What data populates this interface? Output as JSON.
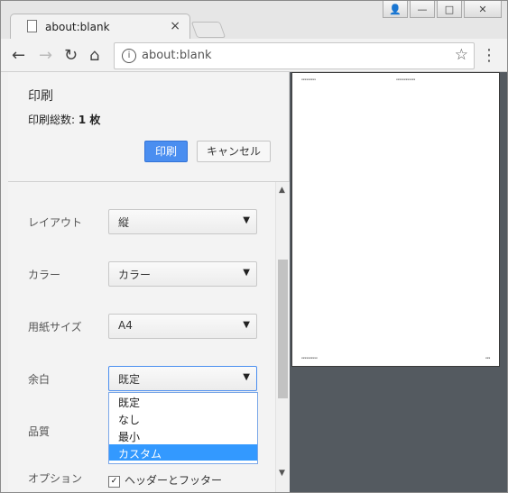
{
  "browser": {
    "tab_title": "about:blank",
    "tab_close": "×",
    "url": "about:blank",
    "window_buttons": [
      "user-icon",
      "minimize-icon",
      "maximize-icon",
      "close-icon"
    ]
  },
  "print": {
    "title": "印刷",
    "total_label": "印刷総数:",
    "total_value": "1 枚",
    "print_button": "印刷",
    "cancel_button": "キャンセル",
    "settings": {
      "layout_label": "レイアウト",
      "layout_value": "縦",
      "color_label": "カラー",
      "color_value": "カラー",
      "paper_label": "用紙サイズ",
      "paper_value": "A4",
      "margin_label": "余白",
      "margin_value": "既定",
      "margin_options": [
        "既定",
        "なし",
        "最小",
        "カスタム"
      ],
      "margin_highlighted": "カスタム",
      "quality_label": "品質",
      "options_label": "オプション",
      "header_footer_label": "ヘッダーとフッター"
    }
  },
  "preview": {
    "header_left": "xxxxxxxxx",
    "header_center": "xxxxxxxxxxxx",
    "footer_left": "xxxxxxxxxx",
    "footer_right": "xxx"
  },
  "colors": {
    "accent": "#4a8ef0",
    "highlight": "#3399ff",
    "preview_bg": "#545a60"
  }
}
